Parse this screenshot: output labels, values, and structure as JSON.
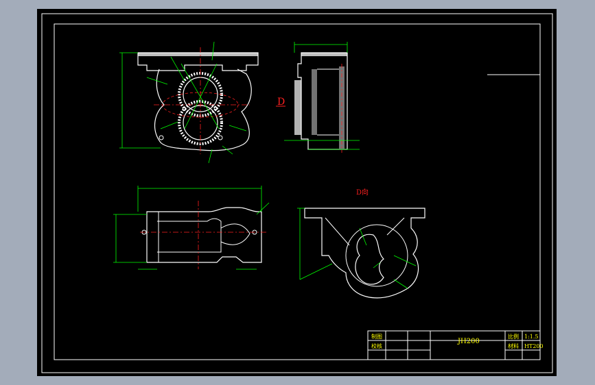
{
  "drawing": {
    "view_letter": "D",
    "view_label": "D向"
  },
  "title_block": {
    "cell_drawn": "制图",
    "cell_checked": "校核",
    "title": "JH200",
    "scale_label": "比例",
    "scale_value": "1:1.5",
    "material_label": "材料",
    "material_value": "HT200"
  },
  "colors": {
    "frame": "#ffffff",
    "outline": "#ffffff",
    "dimension": "#00ff00",
    "centerline": "#ff2020",
    "hatch": "#ffffff",
    "labels": "#ffff00"
  }
}
